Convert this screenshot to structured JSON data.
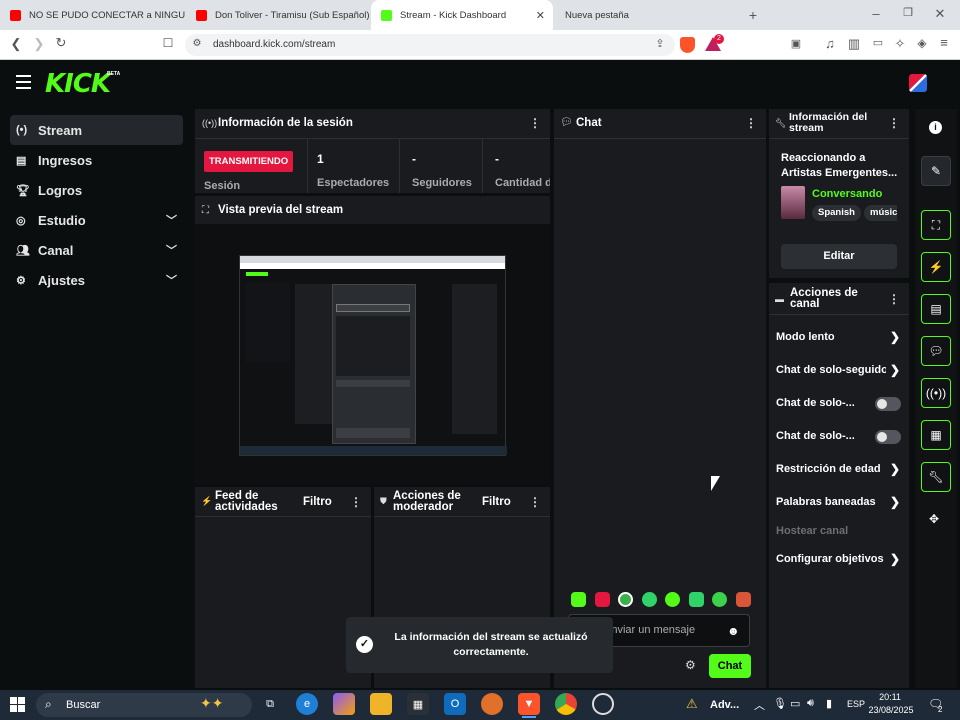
{
  "browser": {
    "tabs": [
      {
        "title": "NO SE PUDO CONECTAR a NINGUN"
      },
      {
        "title": "Don Toliver - Tiramisu (Sub Español)"
      },
      {
        "title": "Stream - Kick Dashboard"
      },
      {
        "title": "Nueva pestaña"
      }
    ],
    "new_tab": "+",
    "url": "dashboard.kick.com/stream",
    "brave_badge": "2"
  },
  "app": {
    "logo": "KICK",
    "beta": "BETA"
  },
  "sidebar": {
    "items": [
      {
        "label": "Stream",
        "icon": "broadcast-icon"
      },
      {
        "label": "Ingresos",
        "icon": "chart-icon"
      },
      {
        "label": "Logros",
        "icon": "trophy-icon"
      },
      {
        "label": "Estudio",
        "icon": "studio-icon"
      },
      {
        "label": "Canal",
        "icon": "users-icon"
      },
      {
        "label": "Ajustes",
        "icon": "gear-icon"
      }
    ]
  },
  "session": {
    "title": "Información de la sesión",
    "status": "TRANSMITIENDO",
    "session_label": "Sesión",
    "stats": [
      {
        "value": "1",
        "label": "Espectadores"
      },
      {
        "value": "-",
        "label": "Seguidores"
      },
      {
        "value": "-",
        "label": "Cantidad d"
      }
    ]
  },
  "preview": {
    "title": "Vista previa del stream"
  },
  "feed": {
    "title": "Feed de actividades",
    "filter": "Filtro"
  },
  "mod": {
    "title": "Acciones de moderador",
    "filter": "Filtro"
  },
  "chat": {
    "title": "Chat",
    "placeholder": "Enviar un mensaje",
    "send": "Chat"
  },
  "toast": {
    "text": "La información del stream se actualizó correctamente."
  },
  "stream_info": {
    "title": "Información del stream",
    "stream_title": "Reaccionando a Artistas Emergentes...",
    "category": "Conversando",
    "tags": [
      "Spanish",
      "músic"
    ],
    "edit": "Editar"
  },
  "channel_actions": {
    "title": "Acciones de canal",
    "items": [
      {
        "label": "Modo lento",
        "type": "arrow"
      },
      {
        "label": "Chat de solo-seguido",
        "type": "arrow"
      },
      {
        "label": "Chat de solo-...",
        "type": "toggle"
      },
      {
        "label": "Chat de solo-...",
        "type": "toggle"
      },
      {
        "label": "Restricción de edad",
        "type": "arrow"
      },
      {
        "label": "Palabras baneadas",
        "type": "arrow"
      },
      {
        "label": "Hostear canal",
        "type": "disabled"
      },
      {
        "label": "Configurar objetivos",
        "type": "arrow"
      }
    ]
  },
  "taskbar": {
    "search": "Buscar",
    "weather": "Adv...",
    "lang": "ESP",
    "time": "20:11",
    "date": "23/08/2025",
    "notifications": "2"
  },
  "colors": {
    "accent": "#53fc18",
    "live": "#e3173f",
    "panel": "#191b1f",
    "bg": "#0b0e0f"
  }
}
